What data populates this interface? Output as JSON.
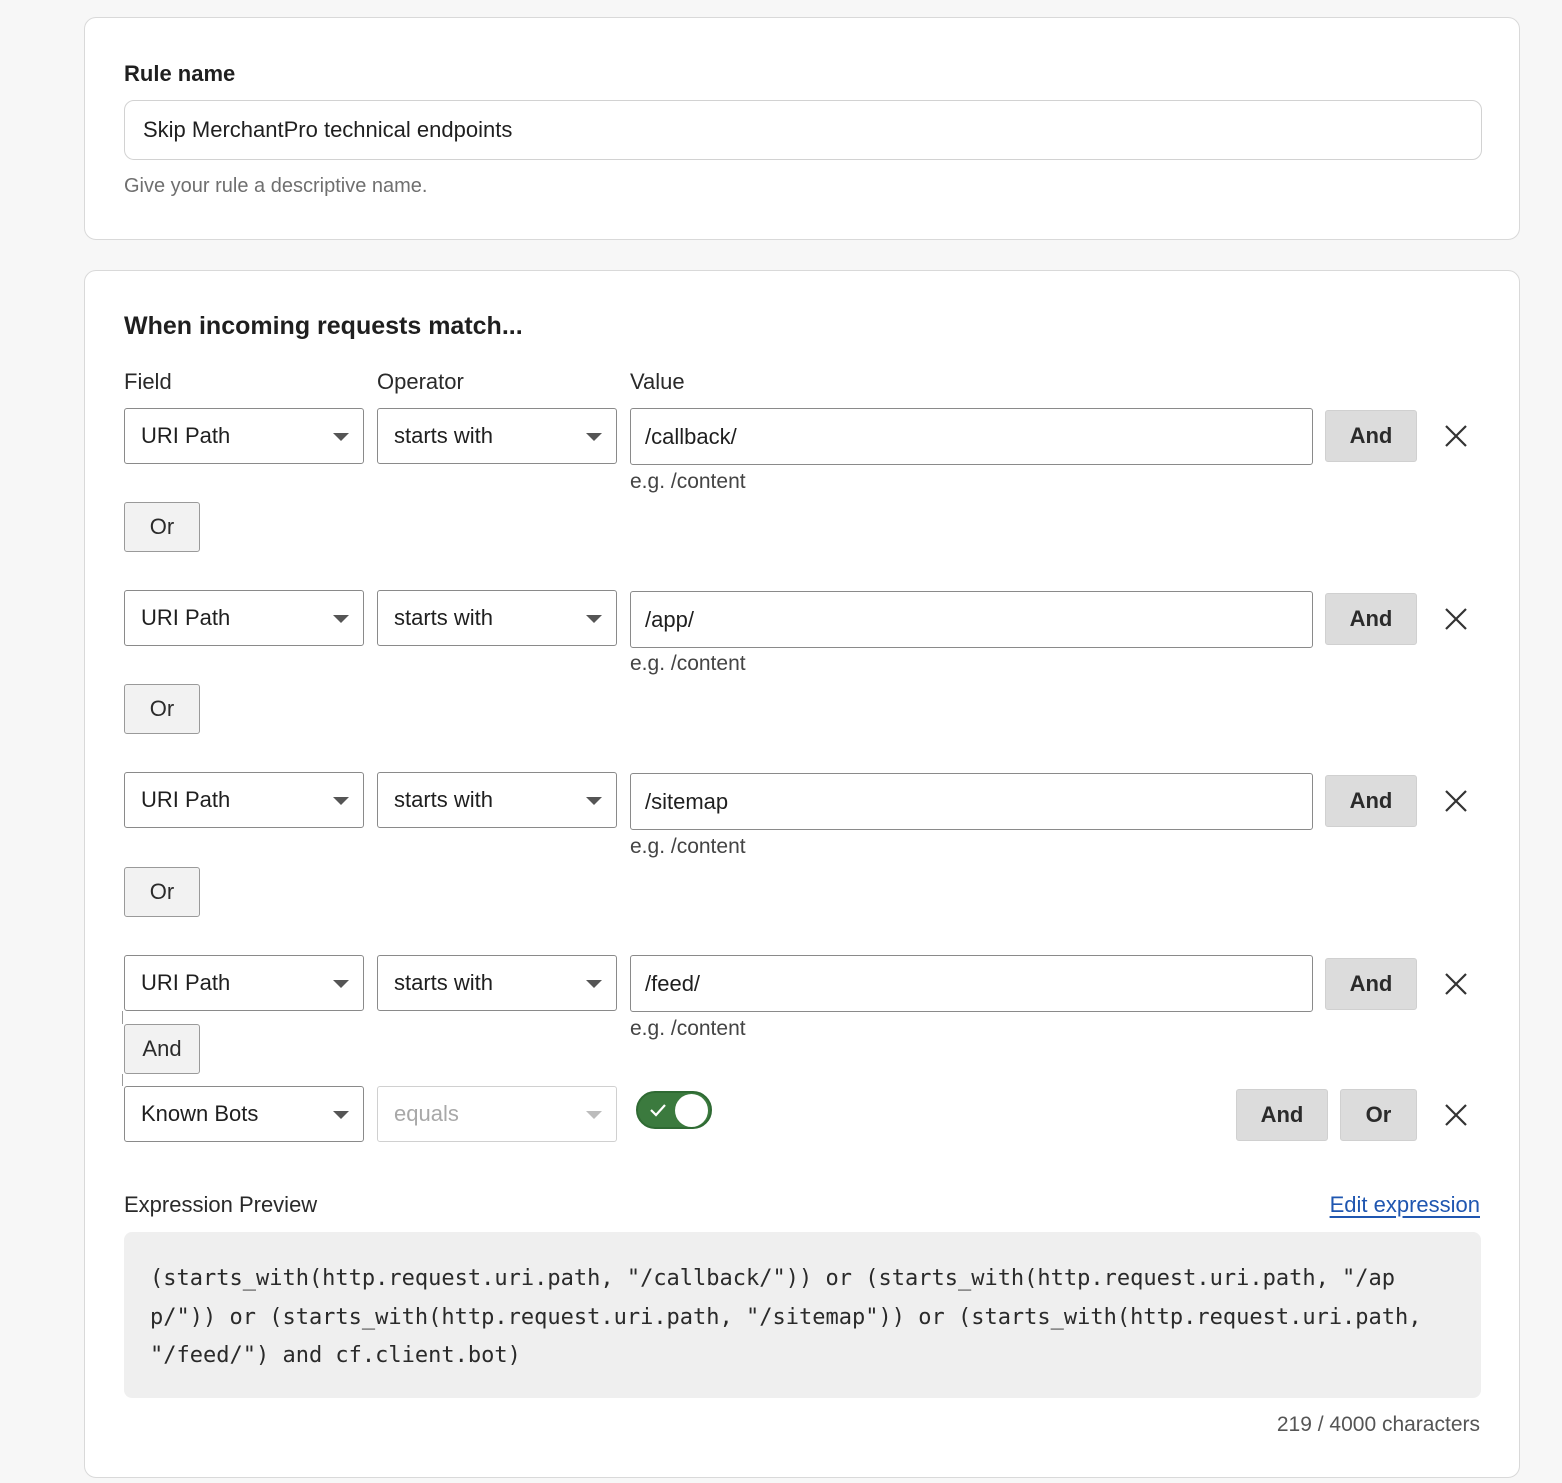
{
  "rule_name": {
    "label": "Rule name",
    "value": "Skip MerchantPro technical endpoints",
    "help": "Give your rule a descriptive name."
  },
  "match": {
    "heading": "When incoming requests match...",
    "columns": {
      "field": "Field",
      "operator": "Operator",
      "value": "Value"
    },
    "conditions": [
      {
        "field": "URI Path",
        "operator": "starts with",
        "value": "/callback/",
        "hint": "e.g. /content",
        "and_label": "And",
        "connector": "Or"
      },
      {
        "field": "URI Path",
        "operator": "starts with",
        "value": "/app/",
        "hint": "e.g. /content",
        "and_label": "And",
        "connector": "Or"
      },
      {
        "field": "URI Path",
        "operator": "starts with",
        "value": "/sitemap",
        "hint": "e.g. /content",
        "and_label": "And",
        "connector": "Or"
      },
      {
        "field": "URI Path",
        "operator": "starts with",
        "value": "/feed/",
        "hint": "e.g. /content",
        "and_label": "And",
        "connector": "And"
      },
      {
        "field": "Known Bots",
        "operator": "equals",
        "toggle_on": true,
        "and_label": "And",
        "or_label": "Or"
      }
    ]
  },
  "expression": {
    "label": "Expression Preview",
    "edit_link": "Edit expression",
    "code": "(starts_with(http.request.uri.path, \"/callback/\")) or (starts_with(http.request.uri.path, \"/app/\")) or (starts_with(http.request.uri.path, \"/sitemap\")) or (starts_with(http.request.uri.path, \"/feed/\") and cf.client.bot)",
    "count": "219 / 4000 characters"
  },
  "colors": {
    "toggle_on": "#3b7a3e",
    "link": "#1f56b0",
    "button_gray": "#dcdcdc"
  },
  "icons": {
    "remove": "close-icon",
    "dropdown": "chevron-down-icon",
    "toggle_check": "check-icon"
  }
}
